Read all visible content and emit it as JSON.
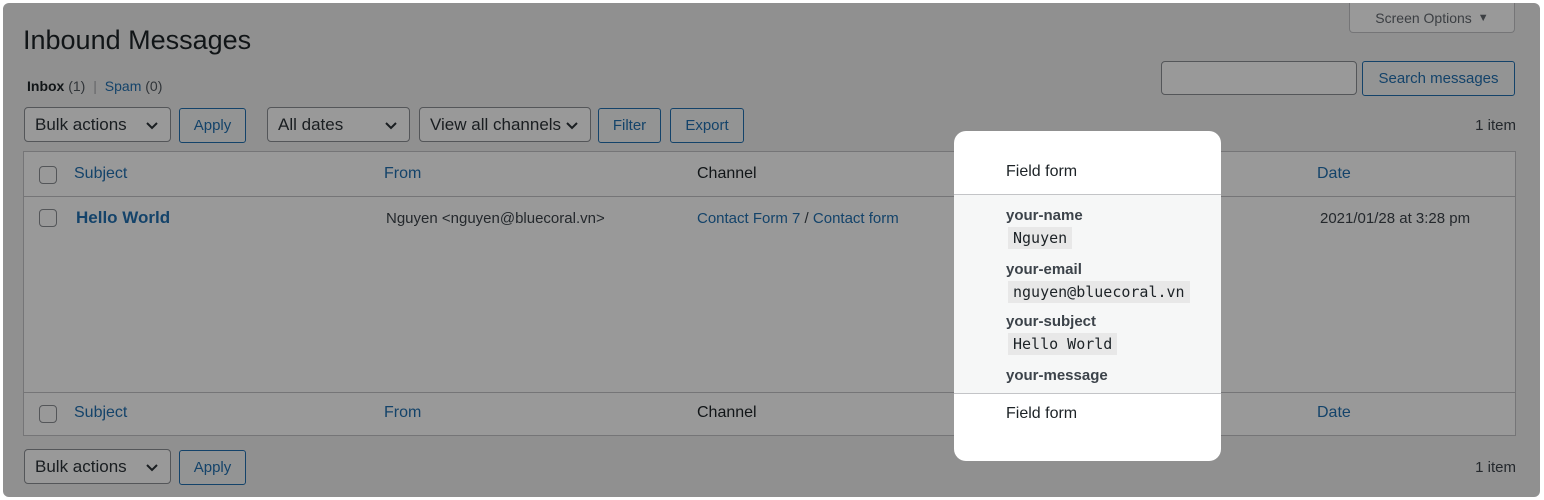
{
  "page": {
    "title": "Inbound Messages"
  },
  "screen_options": {
    "label": "Screen Options",
    "arrow": "▼"
  },
  "views": {
    "inbox_label": "Inbox",
    "inbox_count": "(1)",
    "separator": "|",
    "spam_label": "Spam",
    "spam_count": "(0)"
  },
  "search": {
    "value": "",
    "button_label": "Search messages"
  },
  "filters": {
    "bulk_actions": "Bulk actions",
    "apply": "Apply",
    "dates": "All dates",
    "channels": "View all channels",
    "filter": "Filter",
    "export": "Export",
    "item_count": "1 item"
  },
  "table": {
    "columns": {
      "subject": "Subject",
      "from": "From",
      "channel": "Channel",
      "field_form": "Field form",
      "date": "Date"
    },
    "rows": [
      {
        "subject": "Hello World",
        "from": "Nguyen <nguyen@bluecoral.vn>",
        "channel_parent": "Contact Form 7",
        "channel_sep": "/",
        "channel_child": "Contact form",
        "date": "2021/01/28 at 3:28 pm",
        "fields": [
          {
            "name": "your-name",
            "value": "Nguyen"
          },
          {
            "name": "your-email",
            "value": "nguyen@bluecoral.vn"
          },
          {
            "name": "your-subject",
            "value": "Hello World"
          },
          {
            "name": "your-message",
            "value": ""
          }
        ]
      }
    ]
  },
  "bottom_bar": {
    "bulk_actions": "Bulk actions",
    "apply": "Apply",
    "item_count": "1 item"
  },
  "colors": {
    "link": "#2271b1",
    "overlay": "rgba(0,0,0,0.40)",
    "background": "#f0f0f1"
  }
}
